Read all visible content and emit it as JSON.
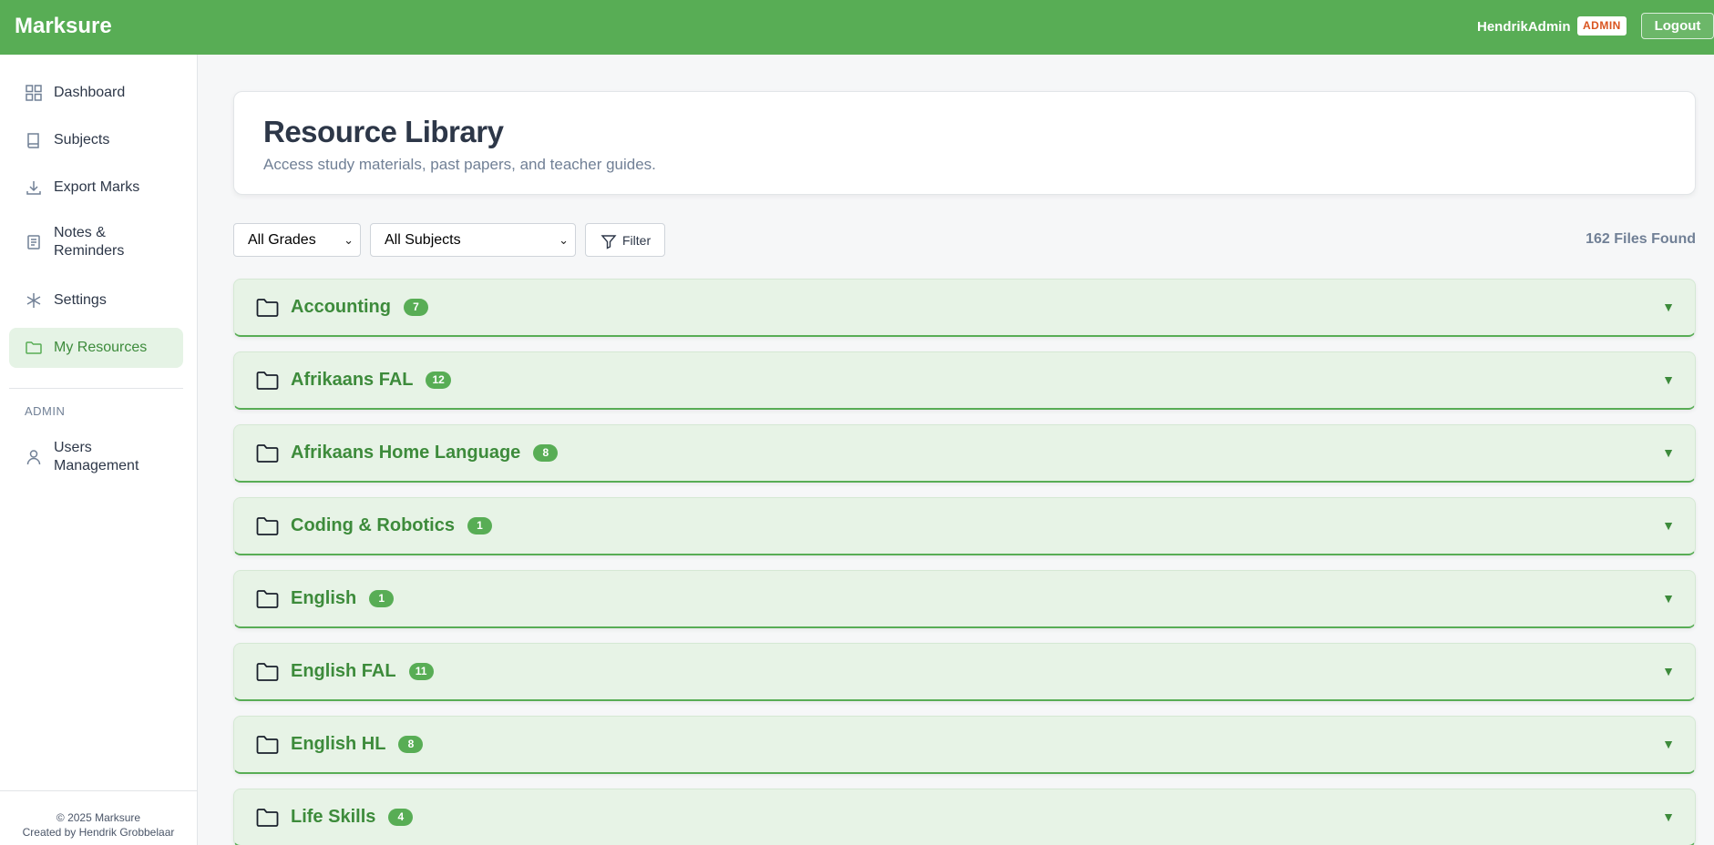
{
  "app": {
    "brand": "Marksure"
  },
  "topbar": {
    "user_name": "HendrikAdmin",
    "role_badge": "ADMIN",
    "logout_label": "Logout"
  },
  "sidebar": {
    "items": [
      {
        "label": "Dashboard",
        "icon": "grid-icon"
      },
      {
        "label": "Subjects",
        "icon": "book-icon"
      },
      {
        "label": "Export Marks",
        "icon": "download-icon"
      },
      {
        "label": "Notes &\nReminders",
        "icon": "notes-icon"
      },
      {
        "label": "Settings",
        "icon": "asterisk-icon"
      },
      {
        "label": "My Resources",
        "icon": "folder-icon",
        "active": true
      }
    ],
    "admin_heading": "ADMIN",
    "admin_items": [
      {
        "label": "Users\nManagement",
        "icon": "user-icon"
      }
    ],
    "footer_line1": "© 2025 Marksure",
    "footer_line2": "Created by Hendrik Grobbelaar"
  },
  "header": {
    "title": "Resource Library",
    "subtitle": "Access study materials, past papers, and teacher guides."
  },
  "filters": {
    "grade_selected": "All Grades",
    "subject_selected": "All Subjects",
    "filter_label": "Filter",
    "file_count": "162 Files Found"
  },
  "folders": [
    {
      "name": "Accounting",
      "count": "7"
    },
    {
      "name": "Afrikaans FAL",
      "count": "12"
    },
    {
      "name": "Afrikaans Home Language",
      "count": "8"
    },
    {
      "name": "Coding & Robotics",
      "count": "1"
    },
    {
      "name": "English",
      "count": "1"
    },
    {
      "name": "English FAL",
      "count": "11"
    },
    {
      "name": "English HL",
      "count": "8"
    },
    {
      "name": "Life Skills",
      "count": "4"
    }
  ],
  "colors": {
    "brand": "#58ad55",
    "accent_text": "#3d8b3b",
    "folder_bg": "#e7f3e6",
    "badge_text": "#d9541f"
  }
}
